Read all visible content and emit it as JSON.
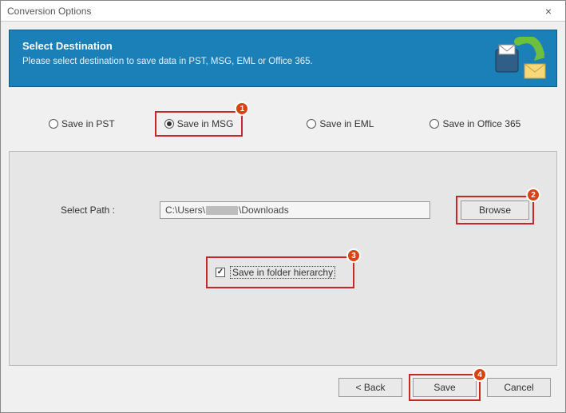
{
  "window": {
    "title": "Conversion Options"
  },
  "header": {
    "title": "Select Destination",
    "subtitle": "Please select destination to save data in PST, MSG, EML or Office 365."
  },
  "radios": {
    "pst": "Save in PST",
    "msg": "Save in MSG",
    "eml": "Save in EML",
    "o365": "Save in Office 365",
    "selected": "msg"
  },
  "annotations": {
    "b1": "1",
    "b2": "2",
    "b3": "3",
    "b4": "4"
  },
  "path": {
    "label": "Select Path :",
    "value_prefix": "C:\\Users\\",
    "value_suffix": "\\Downloads",
    "browse": "Browse"
  },
  "checkbox": {
    "label": "Save in folder hierarchy",
    "checked": true
  },
  "footer": {
    "back": "< Back",
    "save": "Save",
    "cancel": "Cancel"
  }
}
